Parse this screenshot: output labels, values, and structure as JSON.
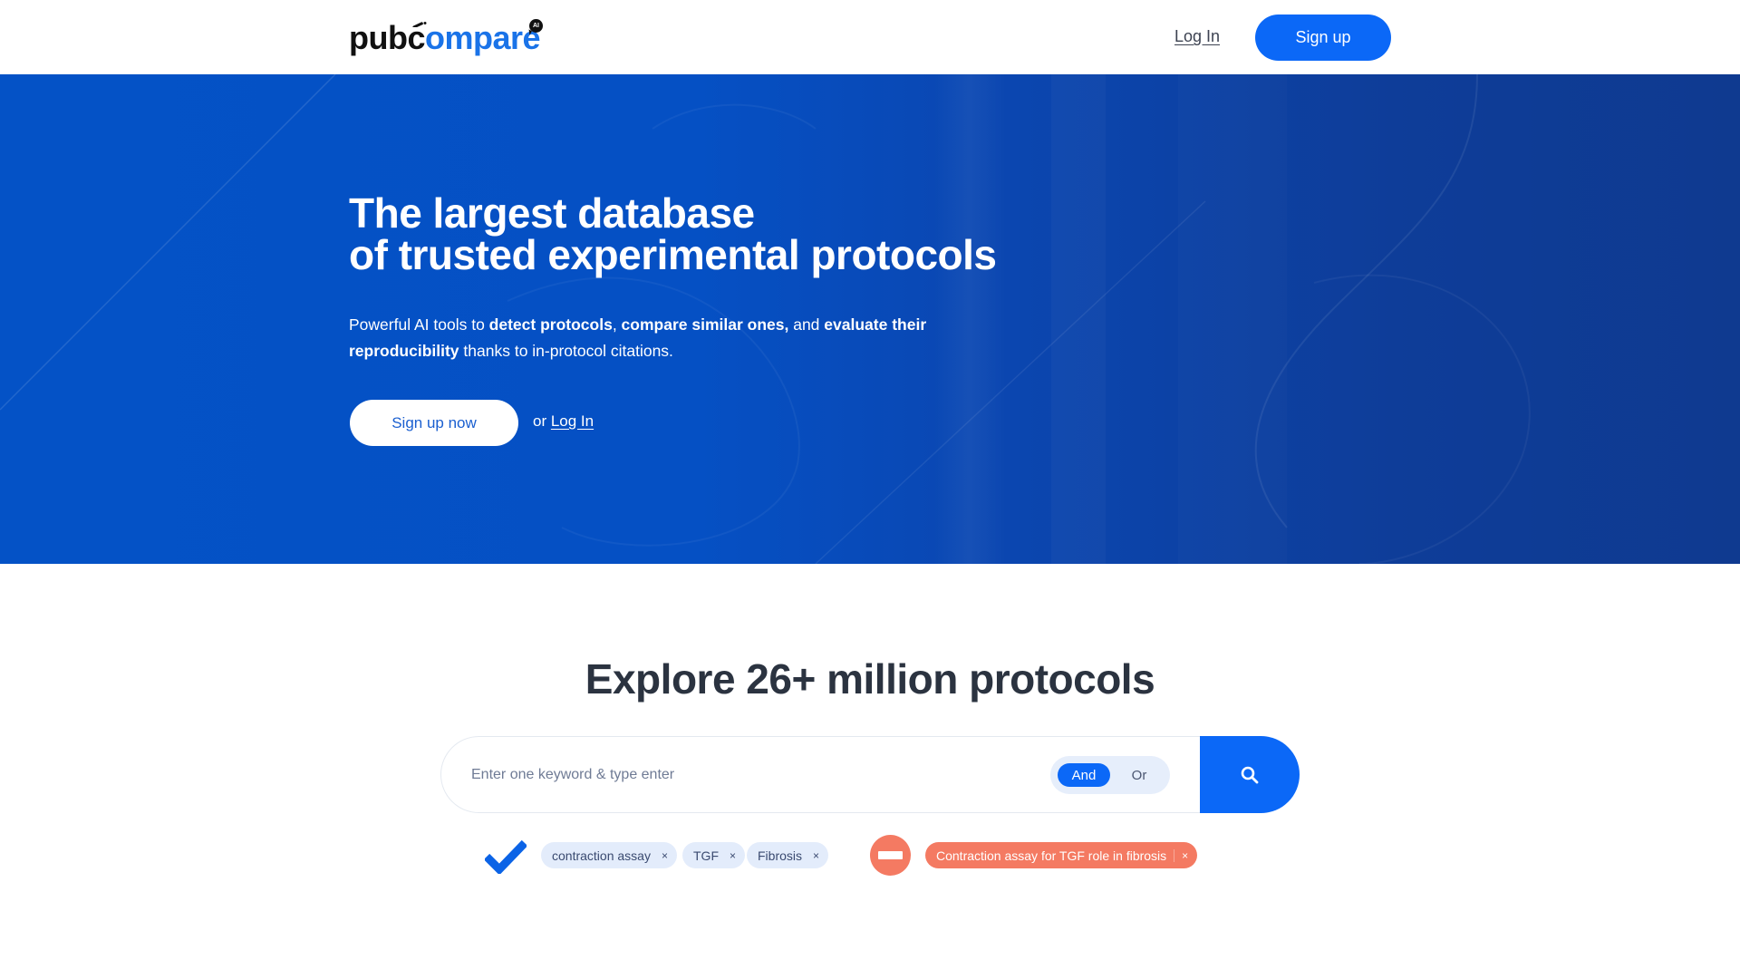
{
  "header": {
    "logo": {
      "part1": "pub",
      "part2": "c",
      "part3": "ompare",
      "badge": "AI"
    },
    "login_label": "Log In",
    "signup_label": "Sign up"
  },
  "hero": {
    "title_line1": "The largest database",
    "title_line2": "of trusted experimental protocols",
    "subtitle": {
      "t1": "Powerful AI tools to ",
      "b1": "detect protocols",
      "t2": ", ",
      "b2": "compare similar ones,",
      "t3": " and ",
      "b3": "evaluate their reproducibility",
      "t4": " thanks to in-protocol citations."
    },
    "cta_label": "Sign up now",
    "or_label": "or ",
    "login_label": "Log In"
  },
  "explore": {
    "title": "Explore 26+ million protocols",
    "search": {
      "placeholder": "Enter one keyword & type enter",
      "value": "",
      "toggle": {
        "options": [
          "And",
          "Or"
        ],
        "selected": "And"
      }
    },
    "good_example": {
      "icon": "checkmark-icon",
      "chips": [
        "contraction assay",
        "TGF",
        "Fibrosis"
      ]
    },
    "bad_example": {
      "icon": "minus-circle-icon",
      "chips": [
        "Contraction assay for TGF role in fibrosis"
      ]
    },
    "remove_glyph": "×"
  },
  "colors": {
    "brand_blue": "#0b68f7",
    "logo_blue": "#1a73e8",
    "hero_blue": "#0452c6",
    "coral": "#f47a62",
    "heading_dark": "#2b3340",
    "chip_bg": "#e3ecfb"
  }
}
